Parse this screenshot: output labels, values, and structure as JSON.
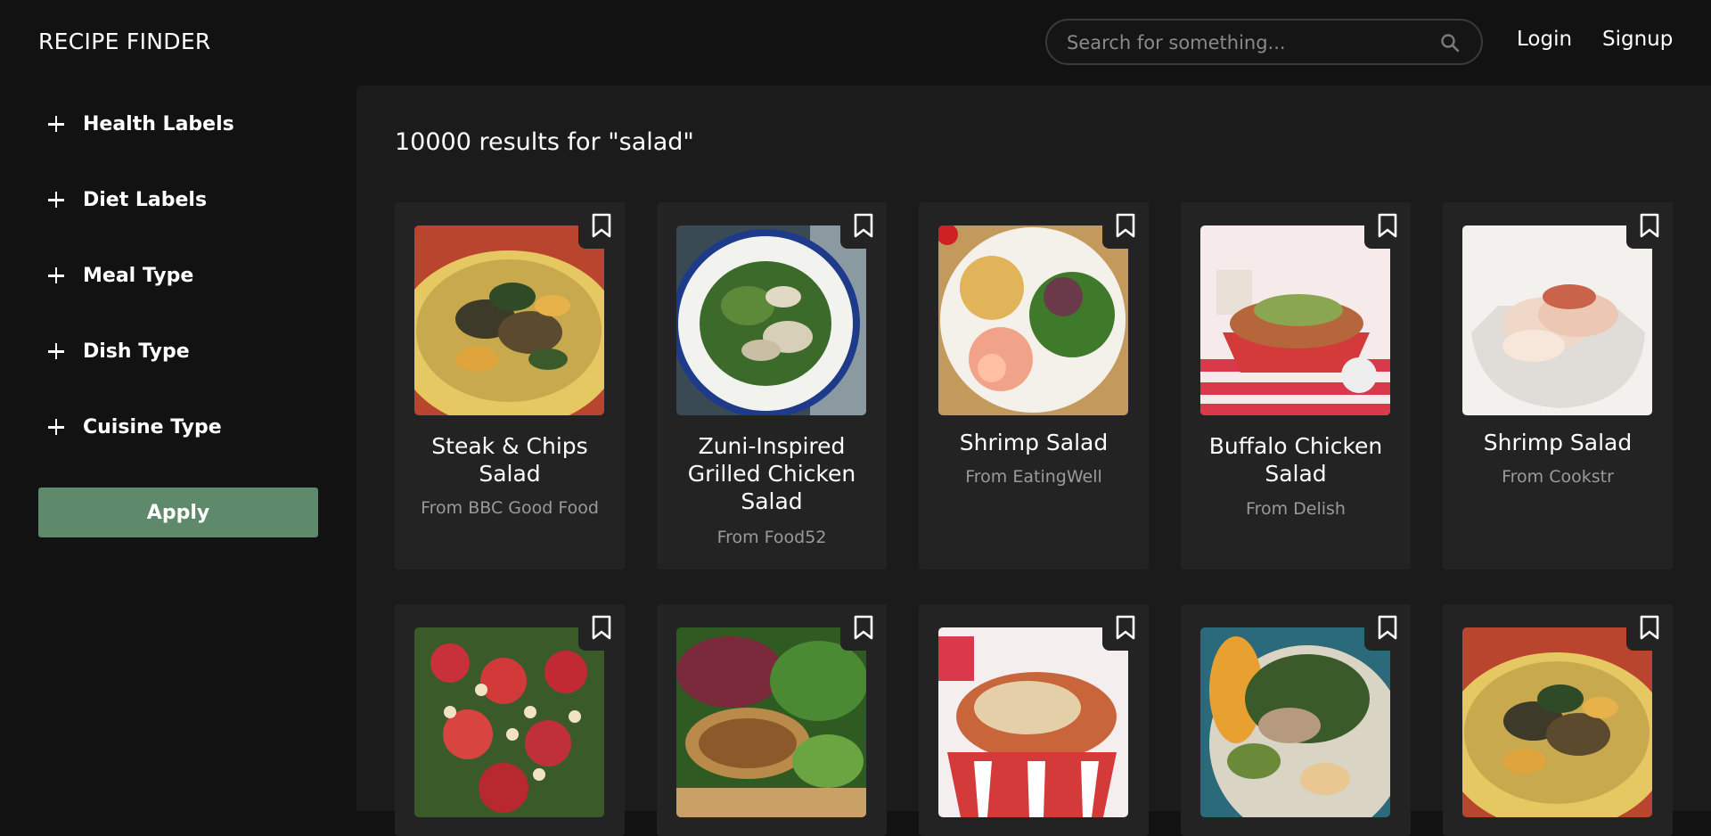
{
  "header": {
    "logo": "RECIPE FINDER",
    "search_placeholder": "Search for something...",
    "search_icon": "search-icon",
    "login": "Login",
    "signup": "Signup"
  },
  "sidebar": {
    "filters": [
      {
        "label": "Health Labels",
        "icon": "plus-icon"
      },
      {
        "label": "Diet Labels",
        "icon": "plus-icon"
      },
      {
        "label": "Meal Type",
        "icon": "plus-icon"
      },
      {
        "label": "Dish Type",
        "icon": "plus-icon"
      },
      {
        "label": "Cuisine Type",
        "icon": "plus-icon"
      }
    ],
    "apply_label": "Apply",
    "apply_color": "#5e8a6b"
  },
  "main": {
    "results_title": "10000 results for \"salad\"",
    "recipes": [
      {
        "name": "Steak & Chips Salad",
        "source": "From BBC Good Food"
      },
      {
        "name": "Zuni-Inspired Grilled Chicken Salad",
        "source": "From Food52"
      },
      {
        "name": "Shrimp Salad",
        "source": "From EatingWell"
      },
      {
        "name": "Buffalo Chicken Salad",
        "source": "From Delish"
      },
      {
        "name": "Shrimp Salad",
        "source": "From Cookstr"
      },
      {
        "name": "",
        "source": ""
      },
      {
        "name": "",
        "source": ""
      },
      {
        "name": "",
        "source": ""
      },
      {
        "name": "",
        "source": ""
      },
      {
        "name": "",
        "source": ""
      }
    ]
  },
  "colors": {
    "background": "#121212",
    "panel": "#1b1b1b",
    "card": "#232323",
    "muted_text": "#9a9a9a"
  }
}
